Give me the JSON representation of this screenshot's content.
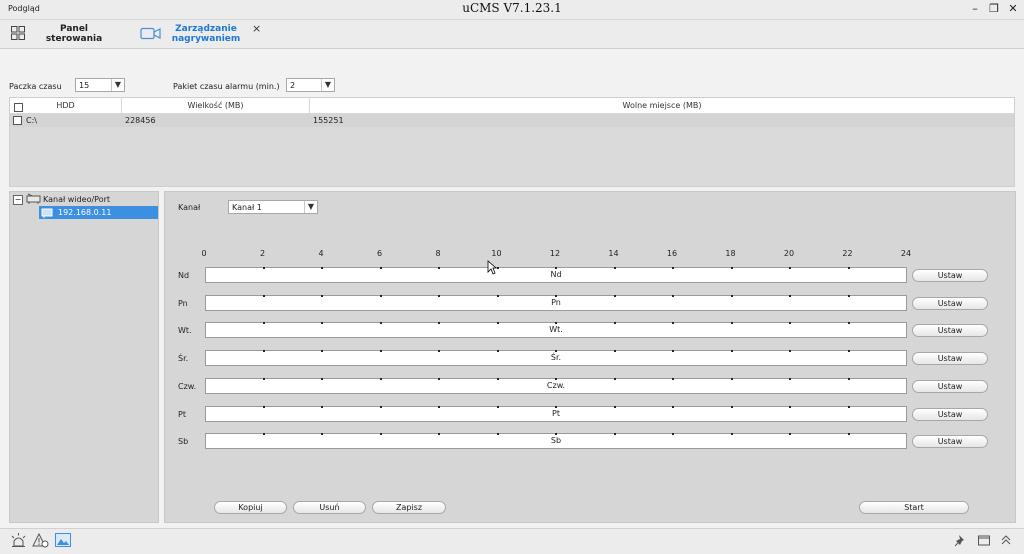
{
  "window": {
    "left_title": "Podgląd",
    "title": "uCMS V7.1.23.1",
    "minimize": "–",
    "restore": "❐",
    "close": "✕"
  },
  "tabs": [
    {
      "label": "Panel sterowania",
      "icon": "grid-icon",
      "active": false
    },
    {
      "label": "Zarządzanie nagrywaniem",
      "icon": "camera-icon",
      "active": true,
      "close": "×"
    }
  ],
  "settings": {
    "pack_time_label": "Paczka czasu",
    "pack_time_value": "15",
    "alarm_pack_label": "Pakiet czasu alarmu (min.)",
    "alarm_pack_value": "2"
  },
  "hdd_table": {
    "headers": [
      "HDD",
      "Wielkość (MB)",
      "Wolne miejsce (MB)"
    ],
    "rows": [
      {
        "hdd": "C:\\",
        "size": "228456",
        "free": "155251"
      }
    ]
  },
  "tree": {
    "root": "Kanał wideo/Port",
    "root_toggle": "−",
    "child": "192.168.0.11"
  },
  "schedule": {
    "channel_label": "Kanał",
    "channel_value": "Kanał 1",
    "hours": [
      "0",
      "2",
      "4",
      "6",
      "8",
      "10",
      "12",
      "14",
      "16",
      "18",
      "20",
      "22",
      "24"
    ],
    "days": [
      {
        "label": "Nd",
        "bar": "Nd",
        "button": "Ustaw"
      },
      {
        "label": "Pn",
        "bar": "Pn",
        "button": "Ustaw"
      },
      {
        "label": "Wt.",
        "bar": "Wt.",
        "button": "Ustaw"
      },
      {
        "label": "Śr.",
        "bar": "Śr.",
        "button": "Ustaw"
      },
      {
        "label": "Czw.",
        "bar": "Czw.",
        "button": "Ustaw"
      },
      {
        "label": "Pt",
        "bar": "Pt",
        "button": "Ustaw"
      },
      {
        "label": "Sb",
        "bar": "Sb",
        "button": "Ustaw"
      }
    ],
    "buttons": {
      "copy": "Kopiuj",
      "delete": "Usuń",
      "save": "Zapisz",
      "start": "Start"
    }
  },
  "colors": {
    "accent": "#1f78d1",
    "tree_selected": "#3d8fe0"
  }
}
